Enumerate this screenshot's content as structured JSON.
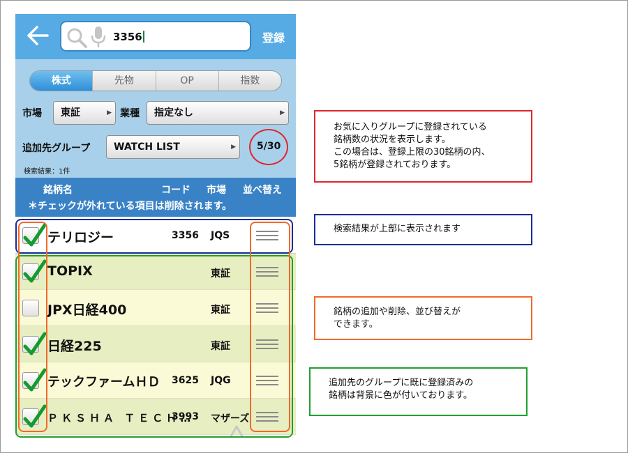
{
  "header": {
    "search_value": "3356",
    "register_label": "登録"
  },
  "tabs": [
    {
      "label": "株式",
      "active": true
    },
    {
      "label": "先物",
      "active": false
    },
    {
      "label": "OP",
      "active": false
    },
    {
      "label": "指数",
      "active": false
    }
  ],
  "filters": {
    "market_label": "市場",
    "market_value": "東証",
    "sector_label": "業種",
    "sector_value": "指定なし",
    "group_label": "追加先グループ",
    "group_value": "WATCH LIST",
    "count": "5/30",
    "result_count": "検索結果：1件"
  },
  "columns": {
    "name": "銘柄名",
    "code": "コード",
    "market": "市場",
    "sort": "並べ替え",
    "note": "＊チェックが外れている項目は削除されます。"
  },
  "rows": [
    {
      "name": "テリロジー",
      "code": "3356",
      "market": "JQS",
      "checked": true
    },
    {
      "name": "TOPIX",
      "code": "",
      "market": "東証",
      "checked": true
    },
    {
      "name": "JPX日経400",
      "code": "",
      "market": "東証",
      "checked": false
    },
    {
      "name": "日経225",
      "code": "",
      "market": "東証",
      "checked": true
    },
    {
      "name": "テックファームＨＤ",
      "code": "3625",
      "market": "JQG",
      "checked": true
    },
    {
      "name": "ＰＫＳＨＡ ＴＥＣＨ…",
      "code": "3993",
      "market": "マザーズ",
      "checked": true
    }
  ],
  "callouts": {
    "red": "お気に入りグループに登録されている\n銘柄数の状況を表示します。\nこの場合は、登録上限の30銘柄の内、\n5銘柄が登録されております。",
    "blue": "検索結果が上部に表示されます",
    "orange": "銘柄の追加や削除、並び替えが\nできます。",
    "green": "追加先のグループに既に登録済みの\n銘柄は背景に色が付いております。"
  },
  "colors": {
    "header_blue": "#56abe4",
    "filter_bg": "#a9d0ea",
    "column_header": "#3a82c6",
    "row_registered_a": "#e7eec1",
    "row_registered_b": "#fbfad7",
    "annotation_red": "#e0262b",
    "annotation_blue": "#1a2c9a",
    "annotation_orange": "#f06a2a",
    "annotation_green": "#1ea12e"
  }
}
